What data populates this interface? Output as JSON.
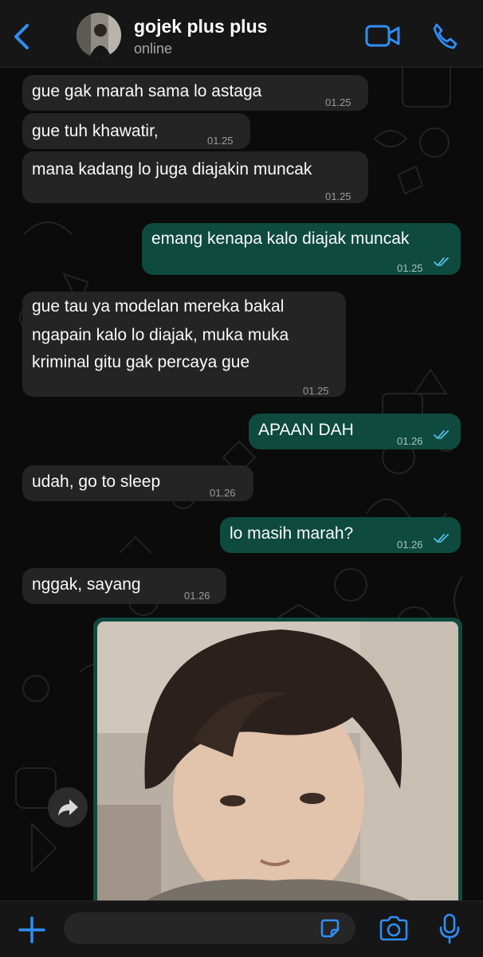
{
  "header": {
    "contact_name": "gojek plus plus",
    "status": "online"
  },
  "colors": {
    "accent": "#2f8ef5",
    "incoming_bubble": "#242424",
    "outgoing_bubble": "#0e4a3e",
    "read_ticks": "#53bdeb"
  },
  "messages": [
    {
      "direction": "incoming",
      "text": "gue gak marah sama lo astaga",
      "time": "01.25"
    },
    {
      "direction": "incoming",
      "text": "gue tuh khawatir,",
      "time": "01.25"
    },
    {
      "direction": "incoming",
      "text": "mana kadang lo juga diajakin muncak",
      "time": "01.25"
    },
    {
      "direction": "outgoing",
      "text": "emang kenapa kalo diajak muncak",
      "time": "01.25",
      "status": "read"
    },
    {
      "direction": "incoming",
      "lines": [
        "gue tau ya modelan mereka bakal",
        "ngapain kalo lo diajak, muka muka",
        "kriminal gitu gak percaya gue"
      ],
      "time": "01.25"
    },
    {
      "direction": "outgoing",
      "text": "APAAN DAH",
      "time": "01.26",
      "status": "read"
    },
    {
      "direction": "incoming",
      "text": "udah, go to sleep",
      "time": "01.26"
    },
    {
      "direction": "outgoing",
      "text": "lo masih marah?",
      "time": "01.26",
      "status": "read"
    },
    {
      "direction": "incoming",
      "text": "nggak, sayang",
      "time": "01.26"
    },
    {
      "direction": "outgoing",
      "type": "photo"
    }
  ],
  "icons": {
    "back": "chevron-left-icon",
    "video_call": "video-camera-icon",
    "voice_call": "phone-icon",
    "forward": "forward-arrow-icon",
    "attach": "plus-icon",
    "sticker": "sticker-icon",
    "camera": "camera-icon",
    "mic": "microphone-icon"
  },
  "input": {
    "placeholder": ""
  }
}
